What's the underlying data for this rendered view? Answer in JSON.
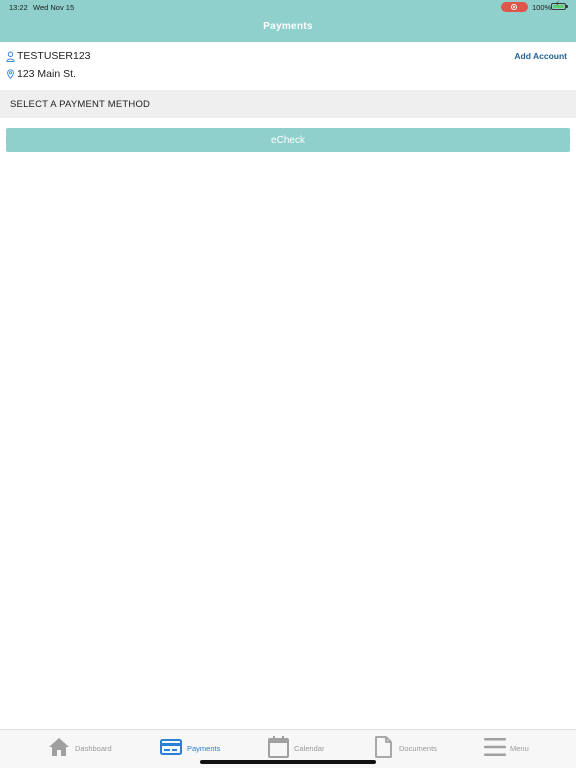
{
  "status_bar": {
    "time": "13:22",
    "date": "Wed Nov 15",
    "battery": "100%"
  },
  "header": {
    "title": "Payments"
  },
  "account": {
    "user": "TESTUSER123",
    "address": "123 Main St.",
    "add_account_label": "Add Account"
  },
  "section": {
    "title": "SELECT A PAYMENT METHOD"
  },
  "payment_methods": [
    {
      "label": "eCheck"
    }
  ],
  "tabs": [
    {
      "label": "Dashboard",
      "icon": "home-icon",
      "active": false
    },
    {
      "label": "Payments",
      "icon": "credit-card-icon",
      "active": true
    },
    {
      "label": "Calendar",
      "icon": "calendar-icon",
      "active": false
    },
    {
      "label": "Documents",
      "icon": "document-icon",
      "active": false
    },
    {
      "label": "Menu",
      "icon": "hamburger-menu-icon",
      "active": false
    }
  ],
  "colors": {
    "brand": "#8fcfcc",
    "link": "#1f5f95",
    "tab_active": "#2a7fd6",
    "tab_inactive": "#9a9a9a"
  }
}
